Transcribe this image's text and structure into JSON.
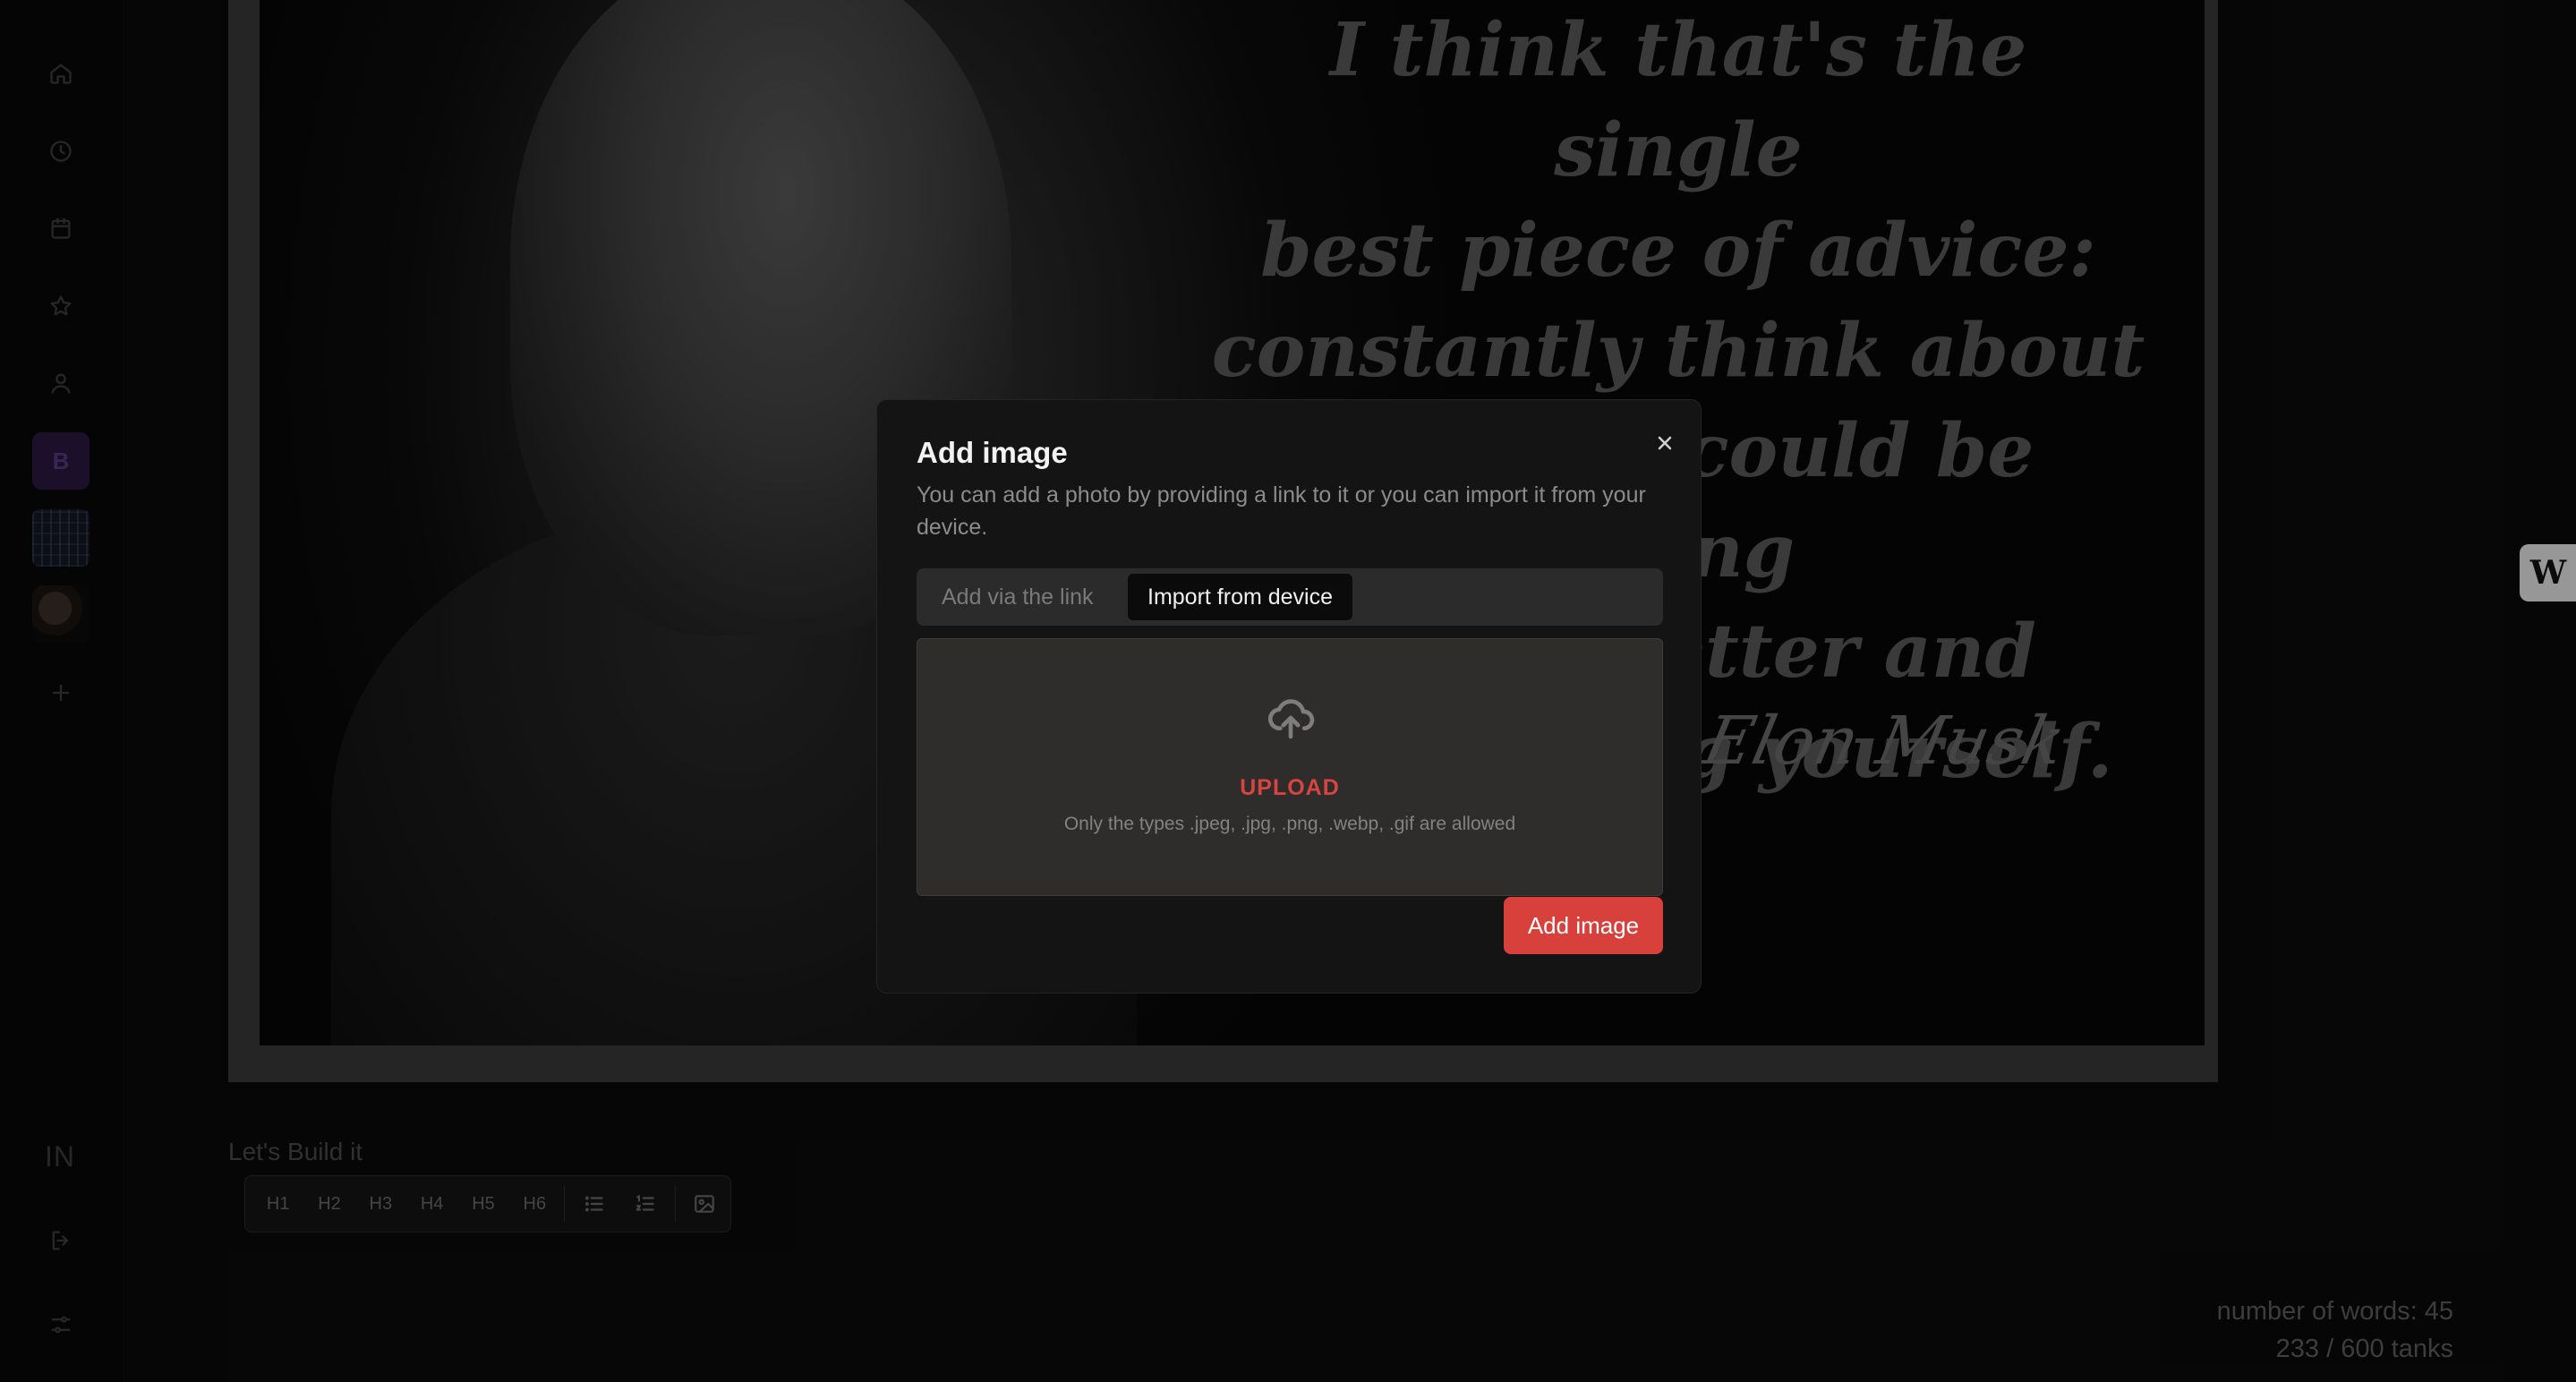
{
  "sidebar": {
    "icons": [
      "home-icon",
      "clock-icon",
      "calendar-icon",
      "star-icon",
      "user-icon"
    ],
    "badge_letter": "B",
    "add_icon": "plus-icon",
    "profile_initials": "IN",
    "bottom_icons": [
      "logout-icon",
      "settings-sliders-icon"
    ]
  },
  "poster": {
    "quote_lines": [
      "I think that's the single",
      "best piece of advice:",
      "constantly think about",
      "how you could be doing",
      "things better and",
      "questioning yourself."
    ],
    "signature": "Elon Musk"
  },
  "editor": {
    "caption": "Let's Build it",
    "toolbar": {
      "h1": "H1",
      "h2": "H2",
      "h3": "H3",
      "h4": "H4",
      "h5": "H5",
      "h6": "H6"
    }
  },
  "stats": {
    "words": "number of words: 45",
    "tanks": "233 / 600 tanks"
  },
  "side_badge": "W",
  "modal": {
    "title": "Add image",
    "description": "You can add a photo by providing a link to it or you can import it from your device.",
    "tabs": [
      {
        "label": "Add via the link",
        "active": false
      },
      {
        "label": "Import from device",
        "active": true
      }
    ],
    "upload_label": "UPLOAD",
    "upload_hint": "Only the types .jpeg, .jpg, .png, .webp, .gif are allowed",
    "submit_label": "Add image"
  },
  "colors": {
    "accent": "#d8403c",
    "background": "#0a0a0a",
    "modal_bg": "#141414"
  }
}
